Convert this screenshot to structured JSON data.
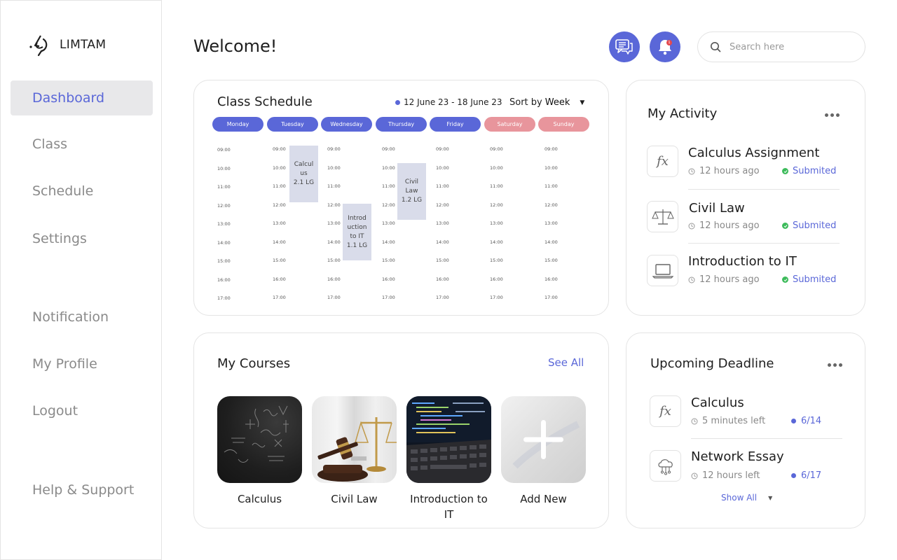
{
  "brand": {
    "name": "LIMTAM"
  },
  "sidebar": {
    "items": [
      {
        "label": "Dashboard"
      },
      {
        "label": "Class"
      },
      {
        "label": "Schedule"
      },
      {
        "label": "Settings"
      },
      {
        "label": "Notification"
      },
      {
        "label": "My Profile"
      },
      {
        "label": "Logout"
      },
      {
        "label": "Help & Support"
      }
    ],
    "active": "Dashboard"
  },
  "header": {
    "title": "Welcome!",
    "search_placeholder": "Search here",
    "notification_badge": "1"
  },
  "schedule": {
    "title": "Class Schedule",
    "date_range": "12 June 23 - 18 June 23",
    "sort_label": "Sort by",
    "sort_value": "Week",
    "days": [
      "Monday",
      "Tuesday",
      "Wednesday",
      "Thursday",
      "Friday",
      "Saturday",
      "Sunday"
    ],
    "times": [
      "09:00",
      "10:00",
      "11:00",
      "12:00",
      "13:00",
      "14:00",
      "15:00",
      "16:00",
      "17:00"
    ],
    "events": [
      {
        "lines": [
          "Calcul",
          "us",
          "2.1 LG"
        ],
        "day": "Tuesday"
      },
      {
        "lines": [
          "Introd",
          "uction",
          "to IT",
          "1.1 LG"
        ],
        "day": "Wednesday"
      },
      {
        "lines": [
          "Civil",
          "Law",
          "1.2 LG"
        ],
        "day": "Thursday"
      }
    ]
  },
  "activity": {
    "title": "My Activity",
    "items": [
      {
        "title": "Calculus Assignment",
        "time": "12 hours ago",
        "status": "Submited",
        "icon": "fx-icon"
      },
      {
        "title": "Civil Law",
        "time": "12 hours ago",
        "status": "Submited",
        "icon": "scales-icon"
      },
      {
        "title": "Introduction to IT",
        "time": "12 hours ago",
        "status": "Submited",
        "icon": "laptop-icon"
      }
    ]
  },
  "courses": {
    "title": "My Courses",
    "see_all": "See All",
    "items": [
      {
        "name": "Calculus"
      },
      {
        "name": "Civil Law"
      },
      {
        "name": "Introduction to IT"
      },
      {
        "name": "Add New"
      }
    ]
  },
  "deadline": {
    "title": "Upcoming Deadline",
    "items": [
      {
        "title": "Calculus",
        "time": "5 minutes left",
        "due": "6/14",
        "icon": "fx-icon"
      },
      {
        "title": "Network Essay",
        "time": "12 hours left",
        "due": "6/17",
        "icon": "cloud-network-icon"
      }
    ],
    "show_all": "Show All"
  },
  "colors": {
    "accent": "#5a67d8",
    "weekend": "#e8959c",
    "event_bg": "#d9dcea",
    "success": "#3dbb5b"
  }
}
